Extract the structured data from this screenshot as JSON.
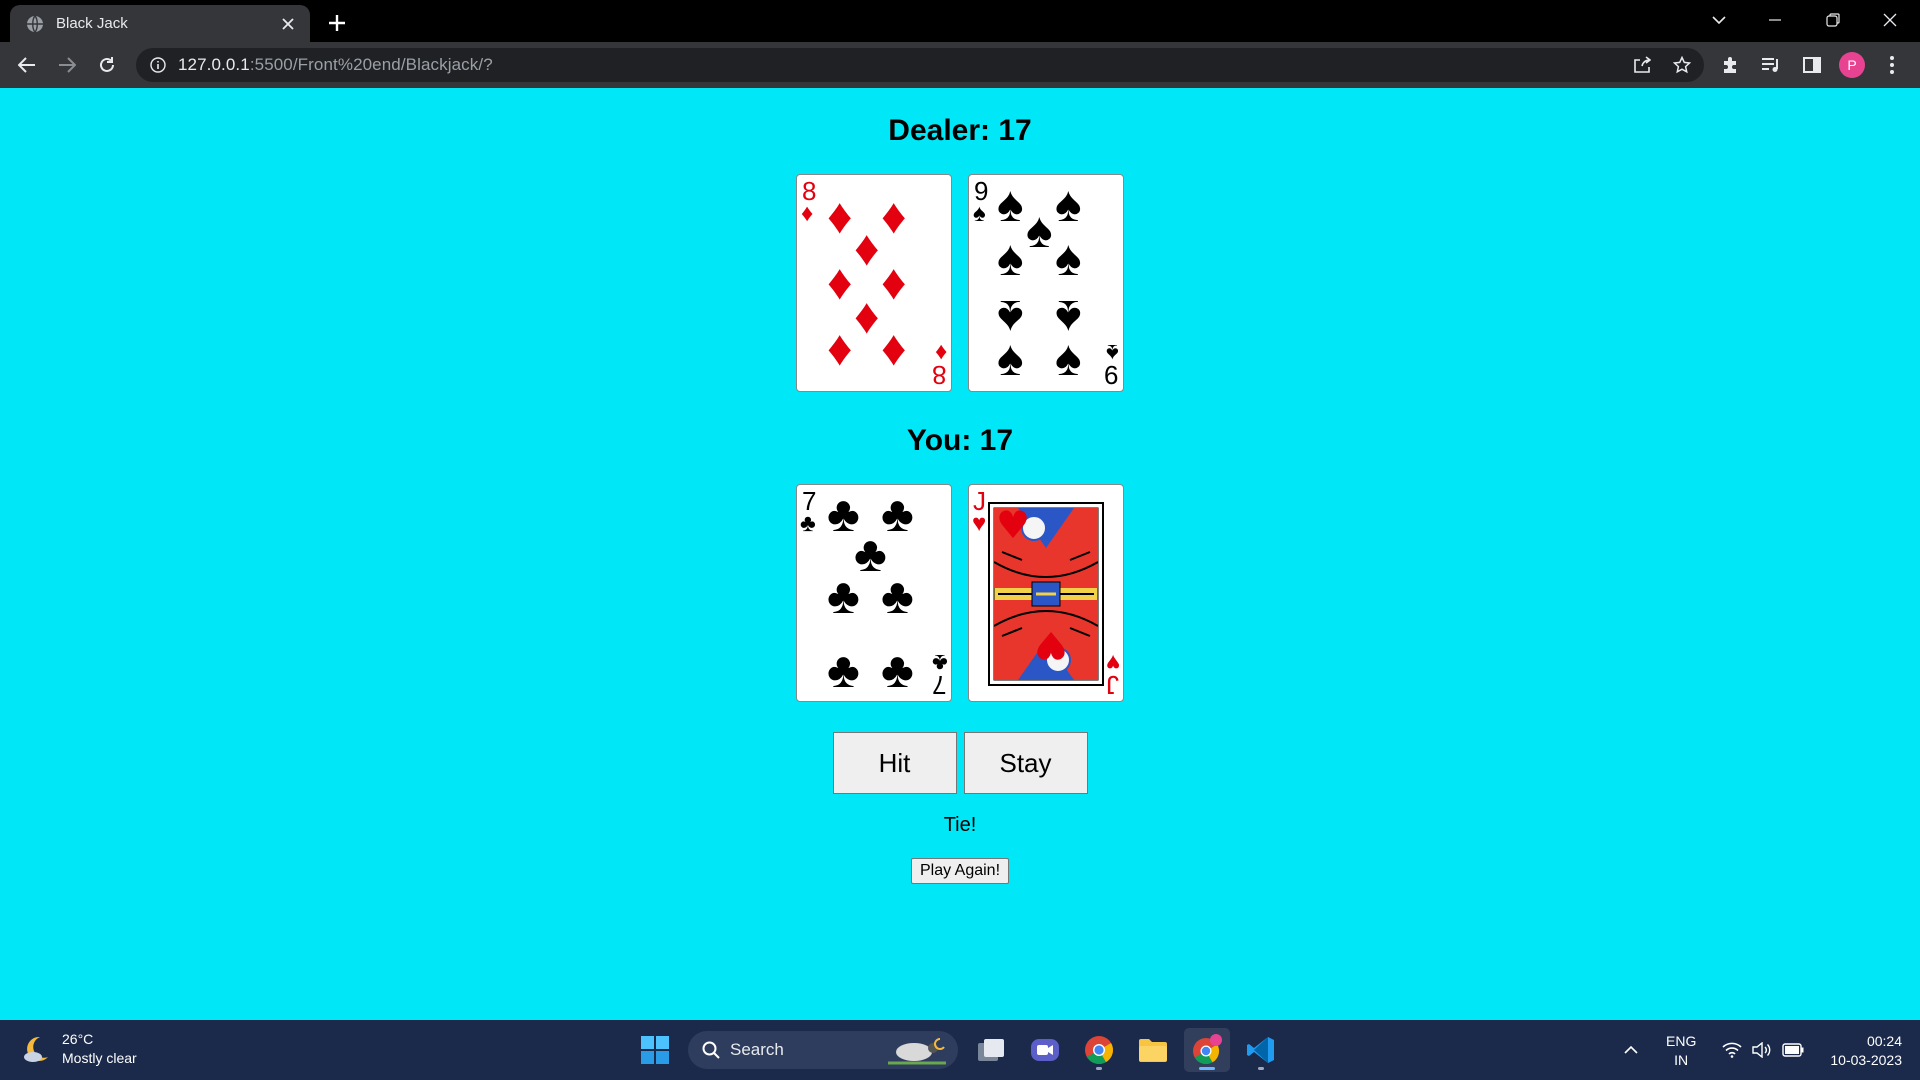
{
  "browser": {
    "tab_title": "Black Jack",
    "url_host": "127.0.0.1",
    "url_rest": ":5500/Front%20end/Blackjack/?",
    "profile_initial": "P"
  },
  "game": {
    "dealer_heading": "Dealer: 17",
    "you_heading": "You: 17",
    "dealer_cards": [
      {
        "rank": "8",
        "suit": "diamonds",
        "suit_symbol": "♦"
      },
      {
        "rank": "9",
        "suit": "spades",
        "suit_symbol": "♠"
      }
    ],
    "player_cards": [
      {
        "rank": "7",
        "suit": "clubs",
        "suit_symbol": "♣"
      },
      {
        "rank": "J",
        "suit": "hearts",
        "suit_symbol": "♥"
      }
    ],
    "hit_label": "Hit",
    "stay_label": "Stay",
    "result_text": "Tie!",
    "play_again_label": "Play Again!"
  },
  "taskbar": {
    "weather_temp": "26°C",
    "weather_desc": "Mostly clear",
    "search_label": "Search",
    "lang_top": "ENG",
    "lang_bottom": "IN",
    "time": "00:24",
    "date": "10-03-2023"
  },
  "colors": {
    "page_background": "#00e8f8",
    "red_suit": "#e3000f",
    "taskbar": "#1b2a4a"
  }
}
